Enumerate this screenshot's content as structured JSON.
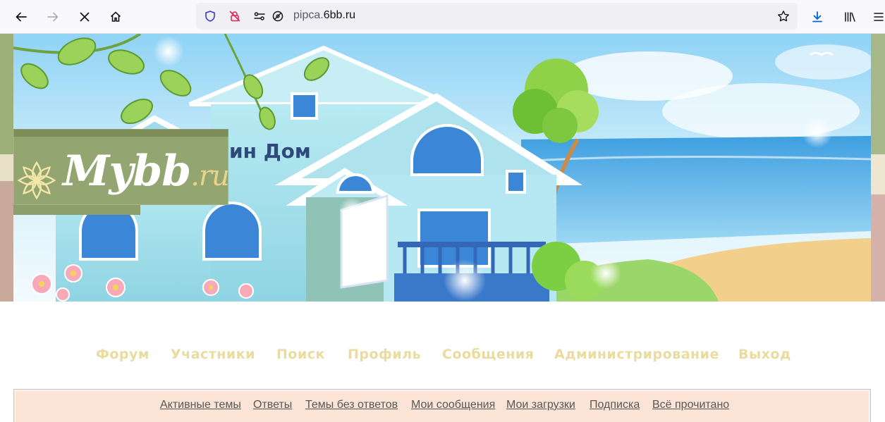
{
  "browser": {
    "url_prefix": "pipca.",
    "url_host": "6bb.ru"
  },
  "banner": {
    "house_title": "ин Дом",
    "logo_main": "Mybb",
    "logo_suffix": ".ru"
  },
  "nav": {
    "items": [
      {
        "label": "Форум"
      },
      {
        "label": "Участники"
      },
      {
        "label": "Поиск"
      },
      {
        "label": "Профиль"
      },
      {
        "label": "Сообщения"
      },
      {
        "label": "Администрирование"
      },
      {
        "label": "Выход"
      }
    ]
  },
  "submenu": {
    "links": [
      {
        "label": "Активные темы"
      },
      {
        "label": "Ответы"
      },
      {
        "label": "Темы без ответов"
      },
      {
        "label": "Мои сообщения"
      },
      {
        "label": "Мои загрузки"
      },
      {
        "label": "Подписка"
      },
      {
        "label": "Всё прочитано"
      }
    ]
  },
  "colors": {
    "nav_text": "#eadb9e",
    "submenu_bg": "#fbe4d6",
    "logo_bg": "#93a672"
  }
}
